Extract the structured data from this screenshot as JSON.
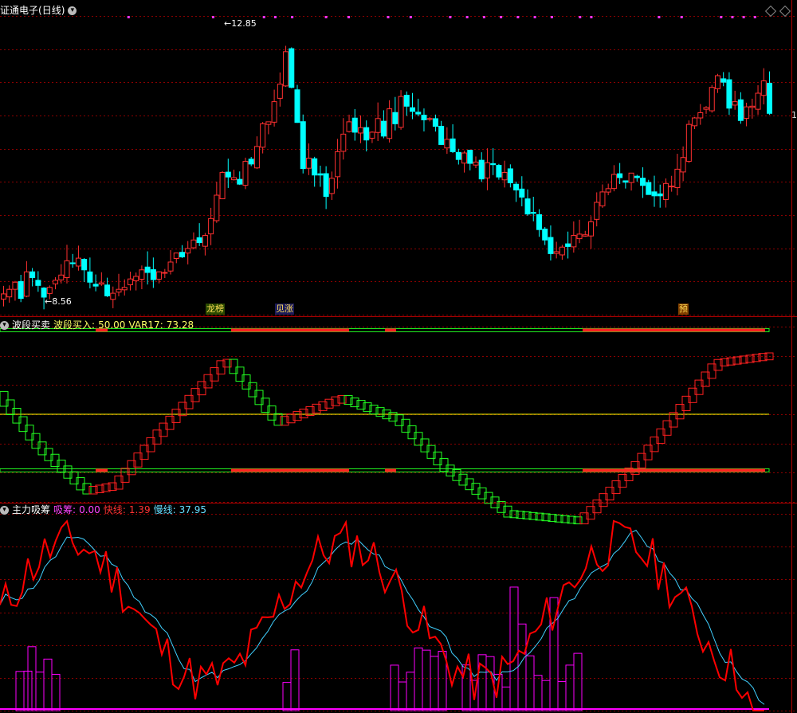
{
  "main_panel": {
    "title": "证通电子",
    "period": "(日线)",
    "high_label": "12.85",
    "low_label": "8.56",
    "right_edge_label": "1",
    "markers": [
      "龙榜",
      "见涨",
      "预"
    ]
  },
  "wave_panel": {
    "name": "波段买卖",
    "buy_label": "波段买入",
    "buy_value": "50.00",
    "var_label": "VAR17",
    "var_value": "73.28"
  },
  "zl_panel": {
    "name": "主力吸筹",
    "absorb_label": "吸筹",
    "absorb_value": "0.00",
    "fast_label": "快线",
    "fast_value": "1.39",
    "slow_label": "慢线",
    "slow_value": "37.95"
  },
  "colors": {
    "up": "#ff3030",
    "down": "#00ffff",
    "wave_up": "#ff2020",
    "wave_down": "#22ff22",
    "mid_line": "#ffff00",
    "fast": "#ff0000",
    "slow": "#40d0ff",
    "absorb": "#ff00ff",
    "grid": "#8b0000",
    "header_name": "#ffffff",
    "header_value": "#ffff66"
  },
  "chart_data": [
    {
      "type": "candlestick",
      "title": "证通电子 (日线)",
      "high_annotation": 12.85,
      "low_annotation": 8.56,
      "closes": [
        8.72,
        8.79,
        8.9,
        8.65,
        9.06,
        8.97,
        8.85,
        8.67,
        8.82,
        8.93,
        9.01,
        9.23,
        9.19,
        9.27,
        9.09,
        8.9,
        8.84,
        8.89,
        8.69,
        8.73,
        8.79,
        8.82,
        8.95,
        8.99,
        9.09,
        9.05,
        8.94,
        9.06,
        9.05,
        9.21,
        9.35,
        9.29,
        9.42,
        9.55,
        9.51,
        9.62,
        9.88,
        10.24,
        10.59,
        10.52,
        10.51,
        10.41,
        10.76,
        10.72,
        10.99,
        11.34,
        11.37,
        11.68,
        11.95,
        12.45,
        11.9,
        11.36,
        10.65,
        10.81,
        10.55,
        10.55,
        10.22,
        10.5,
        10.91,
        11.18,
        11.37,
        11.21,
        11.28,
        11.09,
        11.21,
        11.42,
        11.15,
        11.57,
        11.34,
        11.76,
        11.61,
        11.53,
        11.49,
        11.4,
        11.42,
        11.3,
        11.02,
        11.1,
        10.91,
        10.79,
        10.89,
        10.73,
        10.75,
        10.49,
        10.74,
        10.71,
        10.52,
        10.59,
        10.43,
        10.32,
        10.21,
        9.95,
        9.96,
        9.71,
        9.55,
        9.34,
        9.37,
        9.44,
        9.45,
        9.62,
        9.64,
        9.63,
        9.83,
        10.13,
        10.29,
        10.34,
        10.56,
        10.51,
        10.44,
        10.58,
        10.51,
        10.39,
        10.25,
        10.23,
        10.23,
        10.42,
        10.38,
        10.64,
        10.82,
        11.33,
        11.43,
        11.51,
        11.59,
        11.9,
        12.08,
        11.98,
        11.58,
        11.68,
        11.39,
        11.6,
        11.61,
        11.81,
        12.0,
        11.5
      ],
      "y_range": [
        8.4,
        13.0
      ]
    },
    {
      "type": "line",
      "title": "波段买卖",
      "series": [
        {
          "name": "波段买入",
          "last": 50.0
        },
        {
          "name": "VAR17",
          "last": 73.28
        }
      ],
      "y_range": [
        0,
        100
      ]
    },
    {
      "type": "line",
      "title": "主力吸筹",
      "series": [
        {
          "name": "吸筹",
          "last": 0.0
        },
        {
          "name": "快线",
          "last": 1.39
        },
        {
          "name": "慢线",
          "last": 37.95
        }
      ],
      "y_range": [
        0,
        100
      ]
    }
  ]
}
